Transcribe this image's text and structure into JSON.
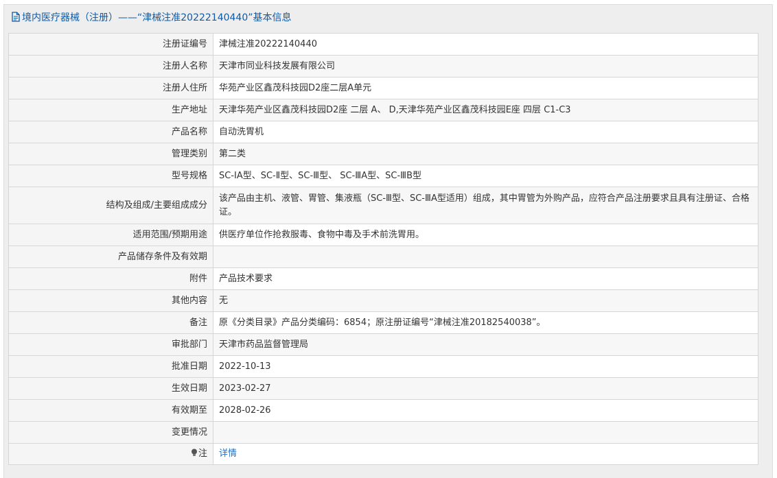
{
  "header": {
    "title": "境内医疗器械（注册）——“津械注准20222140440”基本信息",
    "icon": "document-icon"
  },
  "rows": [
    {
      "label": "注册证编号",
      "value": "津械注准20222140440"
    },
    {
      "label": "注册人名称",
      "value": "天津市同业科技发展有限公司"
    },
    {
      "label": "注册人住所",
      "value": "华苑产业区鑫茂科技园D2座二层A单元"
    },
    {
      "label": "生产地址",
      "value": "天津华苑产业区鑫茂科技园D2座 二层 A、 D,天津华苑产业区鑫茂科技园E座 四层 C1-C3"
    },
    {
      "label": "产品名称",
      "value": "自动洗胃机"
    },
    {
      "label": "管理类别",
      "value": "第二类"
    },
    {
      "label": "型号规格",
      "value": "SC-ⅠA型、SC-Ⅱ型、SC-Ⅲ型、 SC-ⅢA型、SC-ⅢB型"
    },
    {
      "label": "结构及组成/主要组成成分",
      "value": "该产品由主机、液管、胃管、集液瓶（SC-Ⅲ型、SC-ⅢA型适用）组成，其中胃管为外购产品，应符合产品注册要求且具有注册证、合格证。"
    },
    {
      "label": "适用范围/预期用途",
      "value": "供医疗单位作抢救服毒、食物中毒及手术前洗胃用。"
    },
    {
      "label": "产品储存条件及有效期",
      "value": ""
    },
    {
      "label": "附件",
      "value": "产品技术要求"
    },
    {
      "label": "其他内容",
      "value": "无"
    },
    {
      "label": "备注",
      "value": "原《分类目录》产品分类编码：6854；原注册证编号“津械注准20182540038”。"
    },
    {
      "label": "审批部门",
      "value": "天津市药品监督管理局"
    },
    {
      "label": "批准日期",
      "value": "2022-10-13"
    },
    {
      "label": "生效日期",
      "value": "2023-02-27"
    },
    {
      "label": "有效期至",
      "value": "2028-02-26"
    },
    {
      "label": "变更情况",
      "value": ""
    },
    {
      "label": "注",
      "value": "详情",
      "icon": "lightbulb-icon"
    }
  ],
  "colors": {
    "header_text": "#0f5aa6",
    "link": "#1e6fc4",
    "label_bg": "#f5f5f5",
    "border": "#d6d6d6"
  }
}
